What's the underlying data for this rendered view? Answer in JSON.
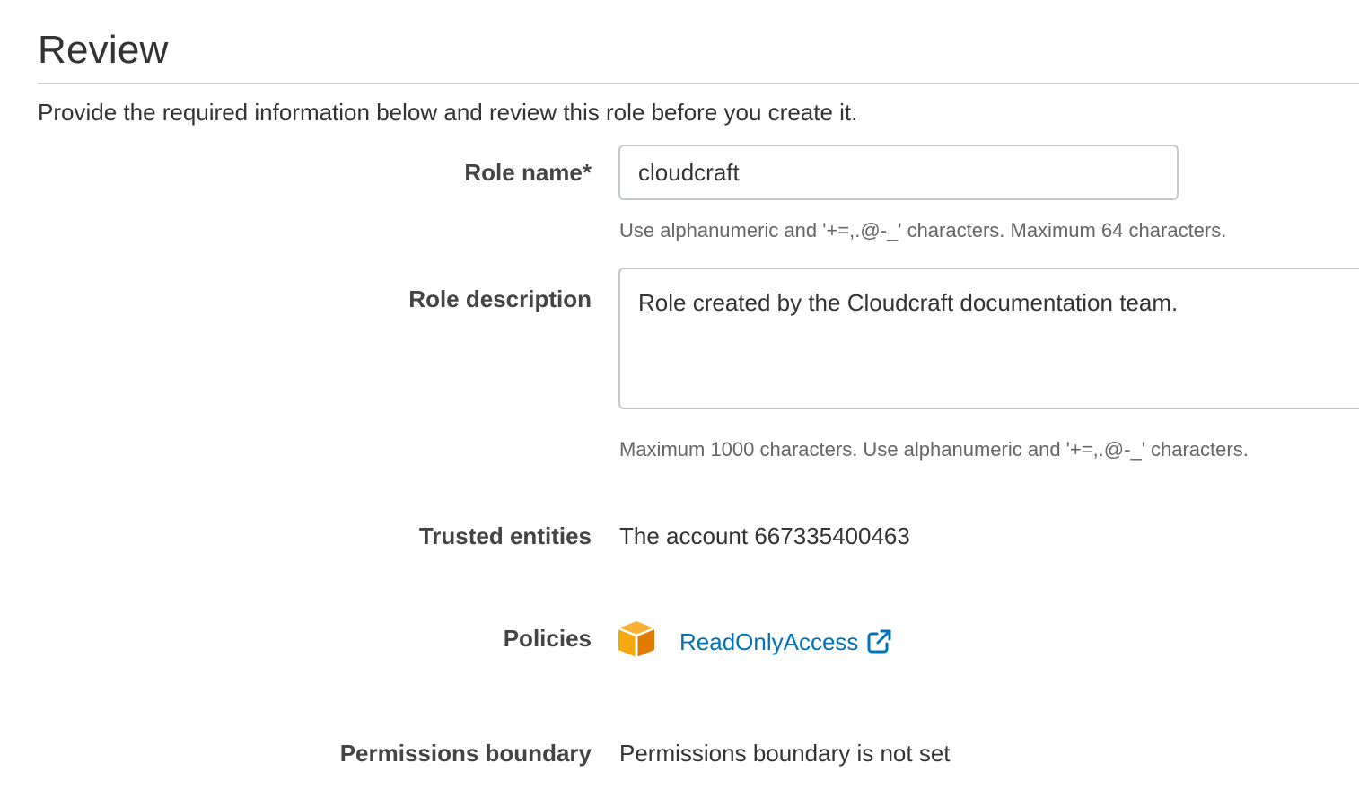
{
  "page": {
    "title": "Review",
    "intro": "Provide the required information below and review this role before you create it."
  },
  "role_name": {
    "label": "Role name*",
    "value": "cloudcraft",
    "hint": "Use alphanumeric and '+=,.@-_' characters. Maximum 64 characters."
  },
  "role_description": {
    "label": "Role description",
    "value": "Role created by the Cloudcraft documentation team.",
    "hint": "Maximum 1000 characters. Use alphanumeric and '+=,.@-_' characters."
  },
  "trusted_entities": {
    "label": "Trusted entities",
    "value": "The account 667335400463"
  },
  "policies": {
    "label": "Policies",
    "items": [
      {
        "name": "ReadOnlyAccess",
        "icon": "aws-managed-policy-cube-icon"
      }
    ]
  },
  "permissions_boundary": {
    "label": "Permissions boundary",
    "value": "Permissions boundary is not set"
  },
  "colors": {
    "link": "#0073bb",
    "policy_icon_light": "#f7a80d",
    "policy_icon_dark": "#e07b00"
  }
}
